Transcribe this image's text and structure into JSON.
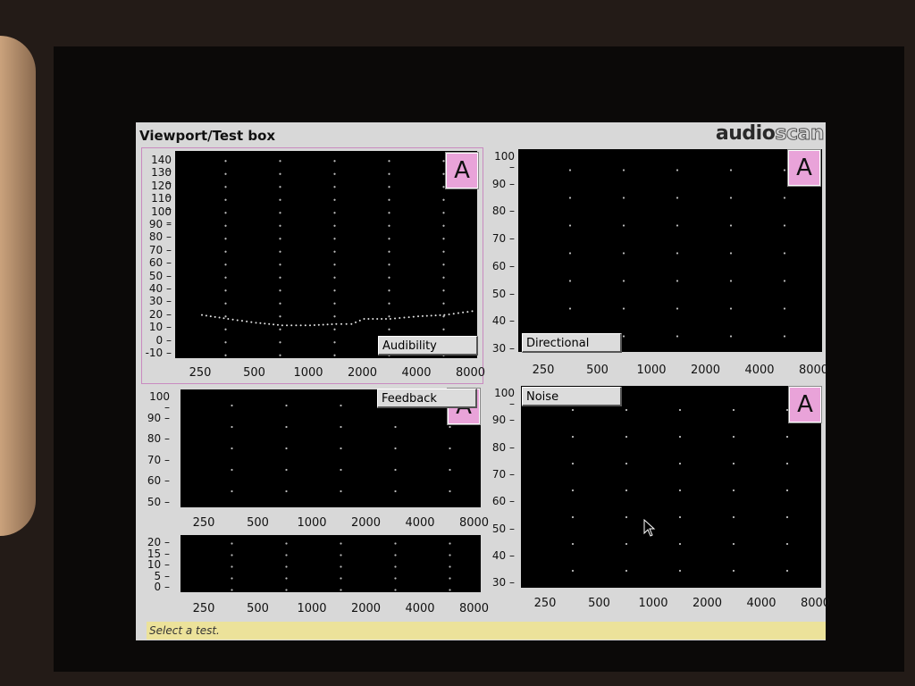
{
  "app": {
    "title": "Viewport/Test box",
    "brand_a": "audio",
    "brand_b": "scan"
  },
  "status": {
    "text": "Select a test."
  },
  "badge": "A",
  "panels": {
    "audibility": {
      "button": "Audibility",
      "y_ticks": [
        "140",
        "130",
        "120",
        "110",
        "100",
        "90",
        "80",
        "70",
        "60",
        "50",
        "40",
        "30",
        "20",
        "10",
        "0",
        "-10"
      ],
      "x_ticks": [
        "250",
        "500",
        "1000",
        "2000",
        "4000",
        "8000"
      ]
    },
    "directional": {
      "button": "Directional",
      "y_ticks": [
        "100",
        "90",
        "80",
        "70",
        "60",
        "50",
        "40",
        "30"
      ],
      "x_ticks": [
        "250",
        "500",
        "1000",
        "2000",
        "4000",
        "8000"
      ]
    },
    "feedback": {
      "button": "Feedback",
      "y_ticks": [
        "100",
        "90",
        "80",
        "70",
        "60",
        "50"
      ],
      "x_ticks": [
        "250",
        "500",
        "1000",
        "2000",
        "4000",
        "8000"
      ]
    },
    "feedback_lower": {
      "y_ticks": [
        "20",
        "15",
        "10",
        "5",
        "0"
      ],
      "x_ticks": [
        "250",
        "500",
        "1000",
        "2000",
        "4000",
        "8000"
      ]
    },
    "noise_reduction": {
      "button": "Noise reduction",
      "y_ticks": [
        "100",
        "90",
        "80",
        "70",
        "60",
        "50",
        "40",
        "30"
      ],
      "x_ticks": [
        "250",
        "500",
        "1000",
        "2000",
        "4000",
        "8000"
      ]
    }
  },
  "audibility_curve": {
    "x_hz": [
      250,
      350,
      500,
      700,
      1000,
      1400,
      1700,
      2000,
      2800,
      4000,
      5600,
      8000
    ],
    "y_db": [
      18,
      15,
      12,
      10,
      10,
      11,
      11,
      15,
      15,
      17,
      18,
      21
    ]
  },
  "colors": {
    "badge": "#e9a3d9",
    "plot_bg": "#000000",
    "status_bg": "#ece29a",
    "frame": "#c98ac0"
  }
}
